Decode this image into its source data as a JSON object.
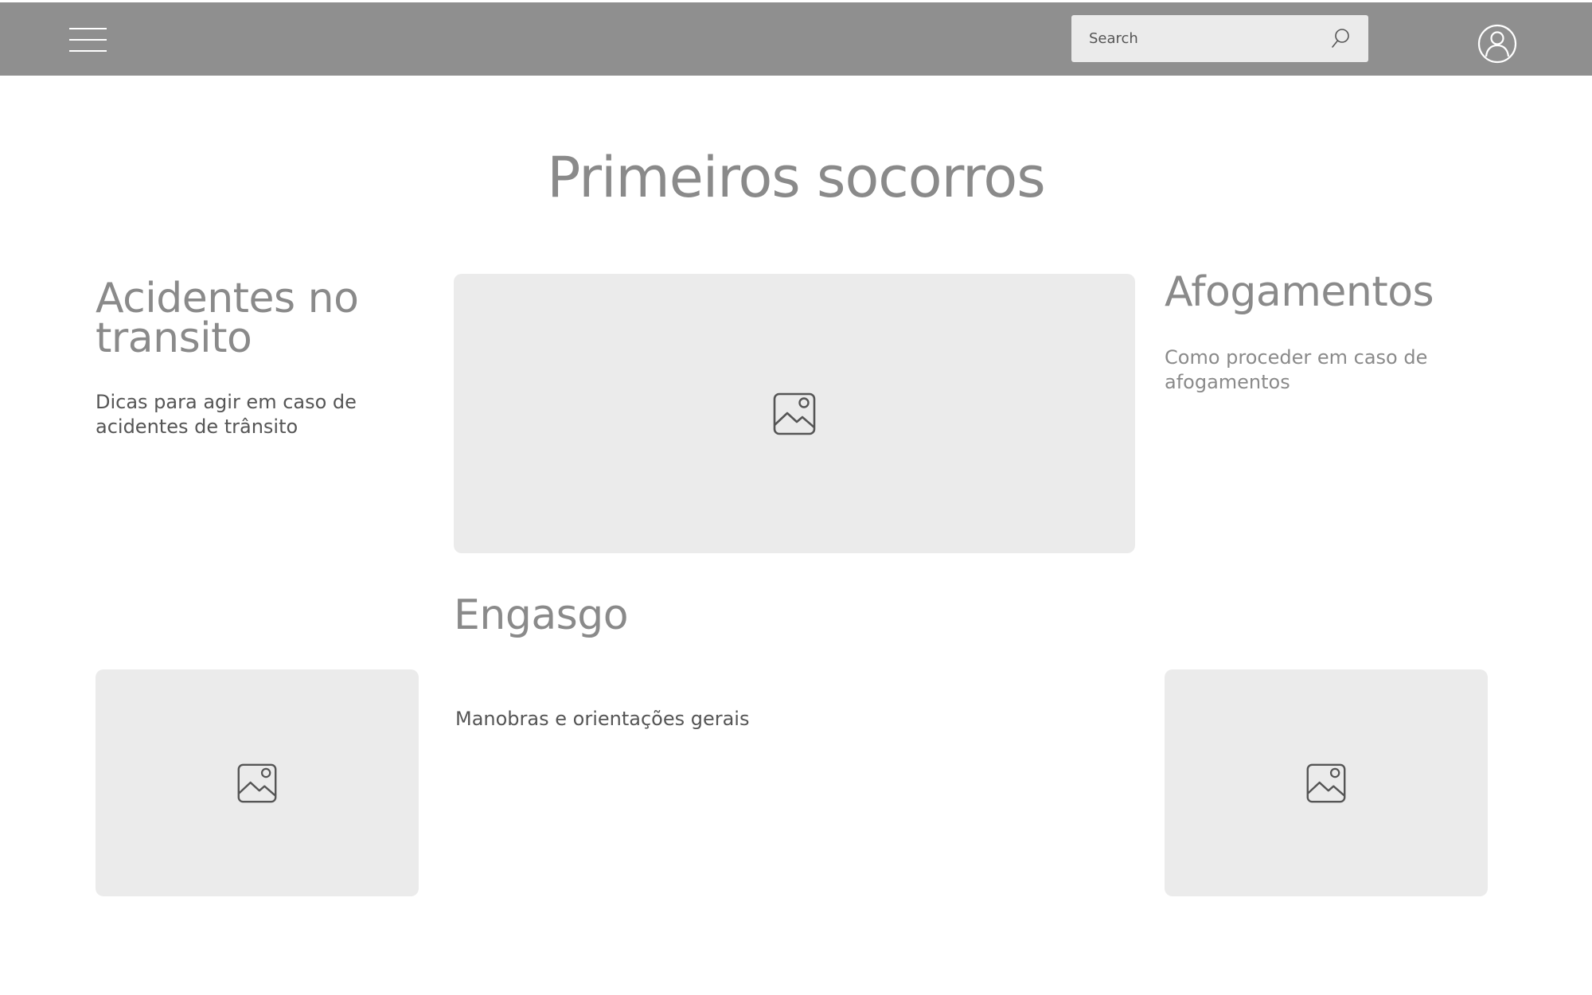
{
  "header": {
    "menu_icon": "hamburger-menu-icon",
    "search": {
      "placeholder": "Search",
      "value": "",
      "icon": "search-icon"
    },
    "profile_icon": "user-avatar-icon"
  },
  "page": {
    "title": "Primeiros socorros"
  },
  "sections": [
    {
      "title": "Acidentes no transito",
      "description": "Dicas para agir em caso de acidentes de trânsito"
    },
    {
      "title": "Afogamentos",
      "description": "Como proceder em caso de afogamentos"
    },
    {
      "title": "Engasgo",
      "description": "Manobras e orientações gerais"
    }
  ],
  "images": {
    "icon": "image-placeholder-icon"
  },
  "colors": {
    "header_bg": "#8f8f8f",
    "placeholder_bg": "#ebebeb",
    "title_text": "#8a8a8a",
    "body_text": "#555555"
  }
}
